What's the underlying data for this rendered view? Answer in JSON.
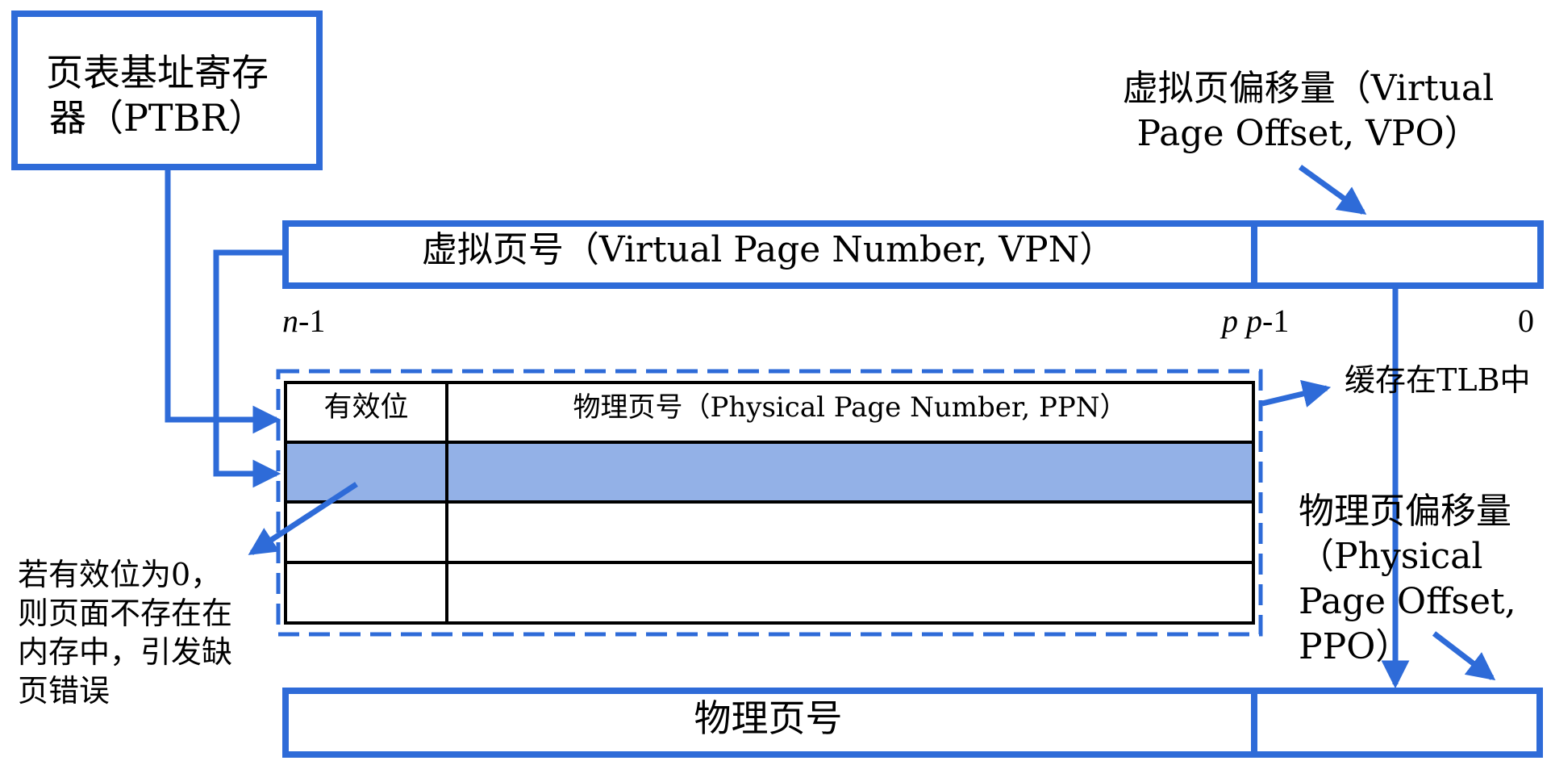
{
  "colors": {
    "accent_blue": "#2E6BD8",
    "highlight_row": "#93B1E7",
    "line_black": "#000000"
  },
  "ptbr_label": "页表基址寄存器（PTBR）",
  "vpo_label": "虚拟页偏移量（Virtual Page Offset, VPO）",
  "vpn_label": "虚拟页号（Virtual Page Number, VPN）",
  "bit_labels": {
    "n_minus_1_var": "n",
    "n_minus_1_rest": "-1",
    "p_var": "p",
    "p_minus_1_var": "p",
    "p_minus_1_rest": "-1",
    "zero": "0"
  },
  "page_table": {
    "valid_header": "有效位",
    "ppn_header": "物理页号（Physical Page Number, PPN）"
  },
  "tlb_label": "缓存在TLB中",
  "fault_note": "若有效位为0，则页面不存在在内存中，引发缺页错误",
  "ppo_label": "物理页偏移量（Physical Page Offset, PPO）",
  "ppn_bottom_label": "物理页号"
}
